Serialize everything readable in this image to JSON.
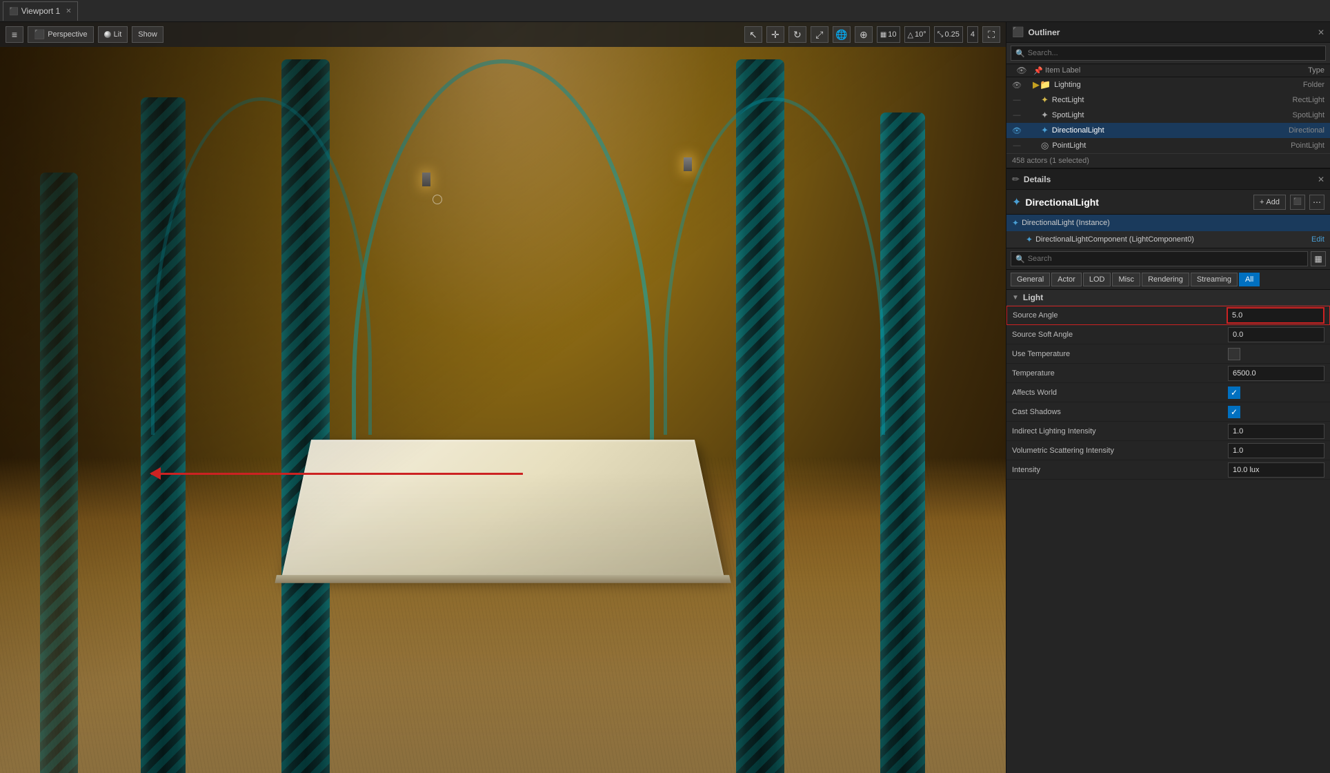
{
  "viewport": {
    "tab_label": "Viewport 1",
    "close_icon": "✕",
    "menu_icon": "≡",
    "perspective_label": "Perspective",
    "lit_label": "Lit",
    "show_label": "Show",
    "toolbar_icons": [
      "↖",
      "✛",
      "↺",
      "⤢",
      "🌐",
      "⊕"
    ],
    "grid_label": "10",
    "angle_label": "10°",
    "scale_label": "0.25",
    "num_label": "4"
  },
  "outliner": {
    "title": "Outliner",
    "close_icon": "✕",
    "search_placeholder": "Search...",
    "col_label": "Item Label",
    "col_type": "Type",
    "items": [
      {
        "id": "lighting-folder",
        "indent": 1,
        "icon": "folder",
        "label": "Lighting",
        "type": "Folder",
        "eye": true,
        "selected": false
      },
      {
        "id": "rect-light",
        "indent": 2,
        "icon": "light",
        "label": "RectLight",
        "type": "RectLight",
        "eye": false,
        "selected": false
      },
      {
        "id": "spot-light",
        "indent": 2,
        "icon": "spot",
        "label": "SpotLight",
        "type": "SpotLight",
        "eye": false,
        "selected": false
      },
      {
        "id": "directional-light",
        "indent": 2,
        "icon": "directional",
        "label": "DirectionalLight",
        "type": "Directional",
        "eye": true,
        "selected": true
      },
      {
        "id": "point-light",
        "indent": 2,
        "icon": "point",
        "label": "PointLight",
        "type": "PointLight",
        "eye": false,
        "selected": false
      }
    ],
    "actor_count": "458 actors (1 selected)"
  },
  "details": {
    "title": "Details",
    "close_icon": "✕",
    "actor_name": "DirectionalLight",
    "add_label": "+ Add",
    "components": [
      {
        "id": "directional-instance",
        "indent": 0,
        "label": "DirectionalLight (Instance)",
        "selected": true
      },
      {
        "id": "directional-component",
        "indent": 1,
        "label": "DirectionalLightComponent (LightComponent0)",
        "edit_label": "Edit"
      }
    ],
    "search_placeholder": "Search",
    "filter_tabs": [
      {
        "label": "General",
        "active": false
      },
      {
        "label": "Actor",
        "active": false
      },
      {
        "label": "LOD",
        "active": false
      },
      {
        "label": "Misc",
        "active": false
      },
      {
        "label": "Rendering",
        "active": false
      },
      {
        "label": "Streaming",
        "active": false
      },
      {
        "label": "All",
        "active": true
      }
    ],
    "sections": [
      {
        "id": "light-section",
        "title": "Light",
        "properties": [
          {
            "id": "source-angle",
            "label": "Source Angle",
            "value": "5.0",
            "type": "number",
            "highlighted": true
          },
          {
            "id": "source-soft-angle",
            "label": "Source Soft Angle",
            "value": "0.0",
            "type": "number",
            "highlighted": false
          },
          {
            "id": "use-temperature",
            "label": "Use Temperature",
            "value": false,
            "type": "checkbox",
            "highlighted": false
          },
          {
            "id": "temperature",
            "label": "Temperature",
            "value": "6500.0",
            "type": "number",
            "highlighted": false
          },
          {
            "id": "affects-world",
            "label": "Affects World",
            "value": true,
            "type": "checkbox",
            "highlighted": false
          },
          {
            "id": "cast-shadows",
            "label": "Cast Shadows",
            "value": true,
            "type": "checkbox",
            "highlighted": false
          },
          {
            "id": "indirect-lighting-intensity",
            "label": "Indirect Lighting Intensity",
            "value": "1.0",
            "type": "number",
            "highlighted": false
          },
          {
            "id": "volumetric-scattering-intensity",
            "label": "Volumetric Scattering Intensity",
            "value": "1.0",
            "type": "number",
            "highlighted": false
          },
          {
            "id": "intensity",
            "label": "Intensity",
            "value": "10.0 lux",
            "type": "number",
            "highlighted": false
          }
        ]
      }
    ]
  }
}
